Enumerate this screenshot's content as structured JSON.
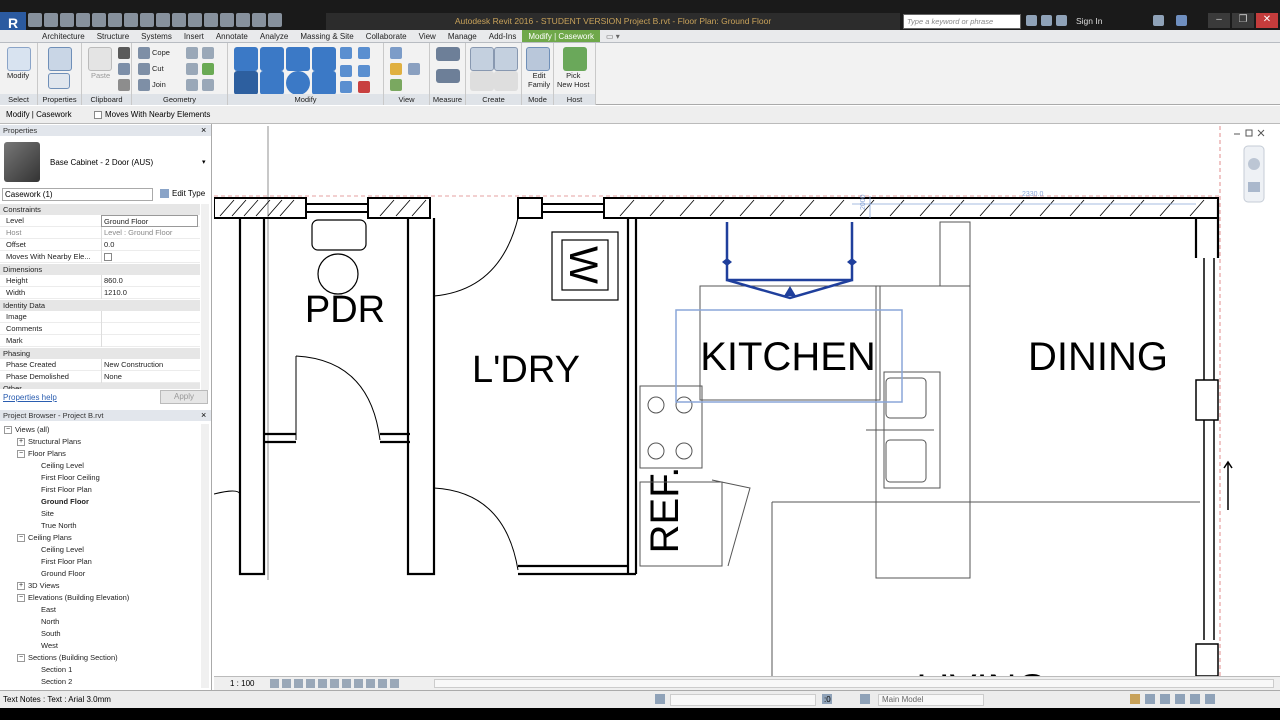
{
  "app": {
    "title": "Autodesk Revit 2016 - STUDENT VERSION    Project B.rvt - Floor Plan: Ground Floor",
    "logo": "R",
    "search_placeholder": "Type a keyword or phrase",
    "sign_in": "Sign In"
  },
  "ribbon_tabs": [
    "Architecture",
    "Structure",
    "Systems",
    "Insert",
    "Annotate",
    "Analyze",
    "Massing & Site",
    "Collaborate",
    "View",
    "Manage",
    "Add-Ins",
    "Modify | Casework"
  ],
  "ribbon": {
    "modify_label": "Modify",
    "select_label": "Select",
    "properties_label": "Properties",
    "clipboard": {
      "label": "Clipboard",
      "paste": "Paste"
    },
    "geometry": {
      "label": "Geometry",
      "cope": "Cope",
      "cut": "Cut",
      "join": "Join"
    },
    "modify_panel": "Modify",
    "view_panel": "View",
    "measure_panel": "Measure",
    "create_panel": "Create",
    "mode": {
      "label": "Mode",
      "edit_family": "Edit\nFamily"
    },
    "host": {
      "label": "Host",
      "pick_new_host": "Pick\nNew Host"
    }
  },
  "options_bar": {
    "context": "Modify | Casework",
    "moves_with": "Moves With Nearby Elements"
  },
  "properties": {
    "header": "Properties",
    "type_name": "Base Cabinet - 2 Door (AUS)",
    "selector": "Casework (1)",
    "edit_type": "Edit Type",
    "groups": {
      "constraints": "Constraints",
      "dimensions": "Dimensions",
      "identity": "Identity Data",
      "phasing": "Phasing",
      "other": "Other"
    },
    "rows": {
      "level": {
        "k": "Level",
        "v": "Ground Floor"
      },
      "host": {
        "k": "Host",
        "v": "Level : Ground Floor"
      },
      "offset": {
        "k": "Offset",
        "v": "0.0"
      },
      "moves": {
        "k": "Moves With Nearby Ele..."
      },
      "height": {
        "k": "Height",
        "v": "860.0"
      },
      "width": {
        "k": "Width",
        "v": "1210.0"
      },
      "image": {
        "k": "Image",
        "v": ""
      },
      "comments": {
        "k": "Comments",
        "v": ""
      },
      "mark": {
        "k": "Mark",
        "v": ""
      },
      "phase_created": {
        "k": "Phase Created",
        "v": "New Construction"
      },
      "phase_demolished": {
        "k": "Phase Demolished",
        "v": "None"
      }
    },
    "help": "Properties help",
    "apply": "Apply"
  },
  "project_browser": {
    "header": "Project Browser - Project B.rvt",
    "items": [
      {
        "label": "Views (all)",
        "depth": 0,
        "toggle": "−"
      },
      {
        "label": "Structural Plans",
        "depth": 1,
        "toggle": "+"
      },
      {
        "label": "Floor Plans",
        "depth": 1,
        "toggle": "−"
      },
      {
        "label": "Ceiling Level",
        "depth": 2,
        "toggle": ""
      },
      {
        "label": "First Floor Ceiling",
        "depth": 2,
        "toggle": ""
      },
      {
        "label": "First Floor Plan",
        "depth": 2,
        "toggle": ""
      },
      {
        "label": "Ground Floor",
        "depth": 2,
        "toggle": "",
        "bold": true
      },
      {
        "label": "Site",
        "depth": 2,
        "toggle": ""
      },
      {
        "label": "True North",
        "depth": 2,
        "toggle": ""
      },
      {
        "label": "Ceiling Plans",
        "depth": 1,
        "toggle": "−"
      },
      {
        "label": "Ceiling Level",
        "depth": 2,
        "toggle": ""
      },
      {
        "label": "First Floor Plan",
        "depth": 2,
        "toggle": ""
      },
      {
        "label": "Ground Floor",
        "depth": 2,
        "toggle": ""
      },
      {
        "label": "3D Views",
        "depth": 1,
        "toggle": "+"
      },
      {
        "label": "Elevations (Building Elevation)",
        "depth": 1,
        "toggle": "−"
      },
      {
        "label": "East",
        "depth": 2,
        "toggle": ""
      },
      {
        "label": "North",
        "depth": 2,
        "toggle": ""
      },
      {
        "label": "South",
        "depth": 2,
        "toggle": ""
      },
      {
        "label": "West",
        "depth": 2,
        "toggle": ""
      },
      {
        "label": "Sections (Building Section)",
        "depth": 1,
        "toggle": "−"
      },
      {
        "label": "Section 1",
        "depth": 2,
        "toggle": ""
      },
      {
        "label": "Section 2",
        "depth": 2,
        "toggle": ""
      }
    ]
  },
  "plan": {
    "rooms": {
      "pdr": "PDR",
      "ldry": "L'DRY",
      "kitchen": "KITCHEN",
      "dining": "DINING",
      "living": "LIVING",
      "ref": "REF.",
      "wm": "W"
    },
    "dims": {
      "d1": "2000",
      "d2": "2330.0"
    }
  },
  "view_bar": {
    "scale": "1 : 100"
  },
  "status": {
    "text": "Text Notes : Text : Arial 3.0mm",
    "coord": ":0",
    "model": "Main Model"
  },
  "colors": {
    "accent": "#6fa84a",
    "selection": "#1f3f9c",
    "title_text": "#c8a25a"
  }
}
